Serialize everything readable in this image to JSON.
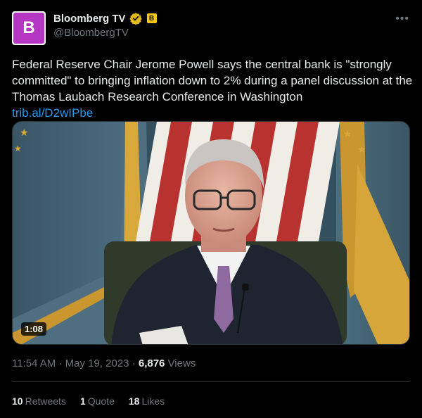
{
  "account": {
    "display_name": "Bloomberg TV",
    "handle": "@BloombergTV",
    "avatar_letter": "B",
    "affiliate_letter": "B",
    "verified_icon": "verified-gold-icon",
    "avatar_color": "#b436c2"
  },
  "tweet": {
    "text": "Federal Reserve Chair Jerome Powell says the central bank is \"strongly committed\" to bringing inflation down to 2% during a panel discussion at the Thomas Laubach Research Conference in Washington",
    "link": "trib.al/D2wIPbe"
  },
  "media": {
    "duration": "1:08"
  },
  "meta": {
    "time": "11:54 AM",
    "separator": "·",
    "date": "May 19, 2023",
    "views_count": "6,876",
    "views_label": "Views"
  },
  "stats": {
    "retweets_count": "10",
    "retweets_label": "Retweets",
    "quotes_count": "1",
    "quotes_label": "Quote",
    "likes_count": "18",
    "likes_label": "Likes"
  },
  "colors": {
    "background": "#000000",
    "text": "#e7e9ea",
    "muted": "#71767b",
    "link": "#1d9bf0"
  }
}
